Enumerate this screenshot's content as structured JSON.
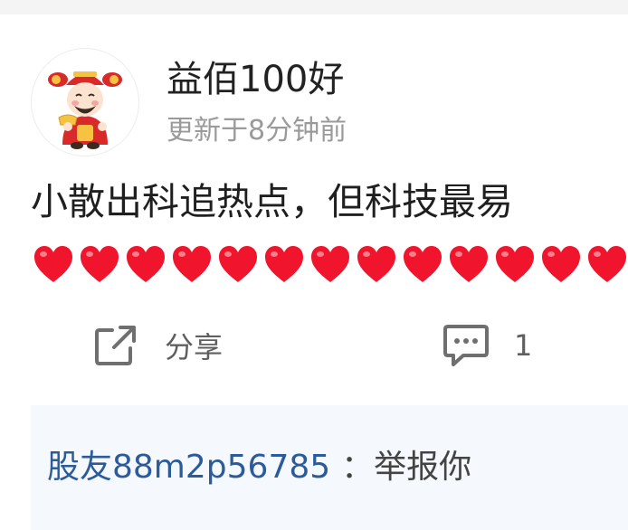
{
  "post": {
    "author_name": "益佰100好",
    "updated_text": "更新于8分钟前",
    "content": "小散出科追热点，但科技最易",
    "hearts_count": 13,
    "heart_color": "#f0142c"
  },
  "actions": {
    "share_label": "分享",
    "comment_count": "1"
  },
  "comment": {
    "author": "股友88m2p56785",
    "separator": "：",
    "text": "举报你"
  },
  "colors": {
    "author_link": "#2c5b9b",
    "comment_bg": "#f5f8fc",
    "icon_gray": "#6f6f6f"
  }
}
